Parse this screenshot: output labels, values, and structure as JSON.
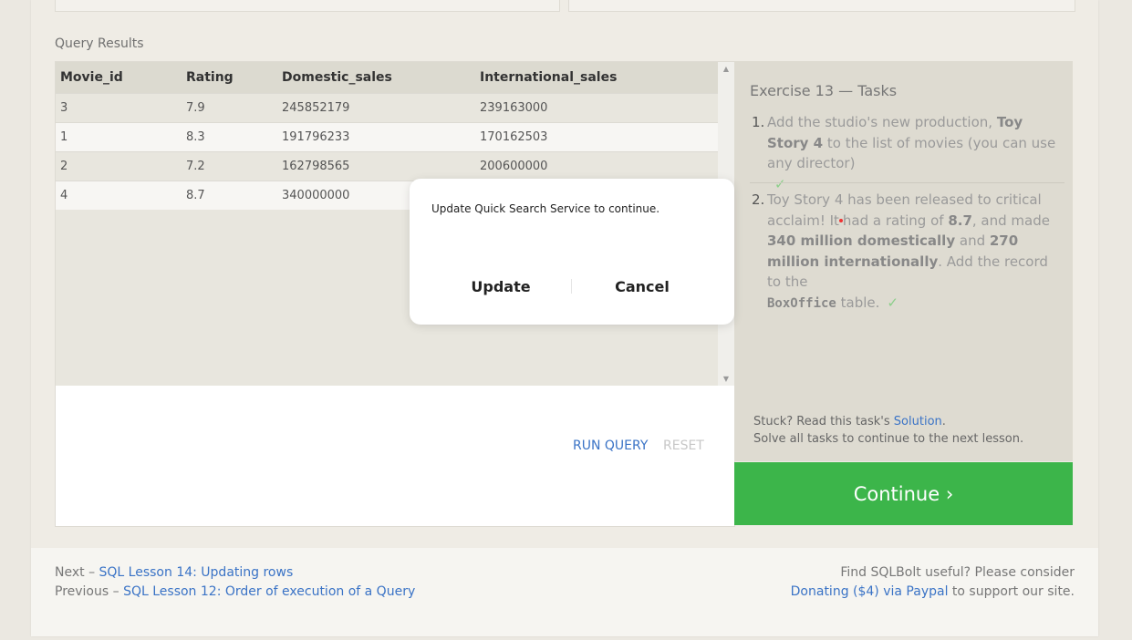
{
  "results": {
    "label": "Query Results",
    "columns": [
      "Movie_id",
      "Rating",
      "Domestic_sales",
      "International_sales"
    ],
    "rows": [
      [
        "3",
        "7.9",
        "245852179",
        "239163000"
      ],
      [
        "1",
        "8.3",
        "191796233",
        "170162503"
      ],
      [
        "2",
        "7.2",
        "162798565",
        "200600000"
      ],
      [
        "4",
        "8.7",
        "340000000",
        ""
      ]
    ],
    "run_query": "RUN QUERY",
    "reset": "RESET"
  },
  "tasks": {
    "title": "Exercise 13 — Tasks",
    "task1": {
      "num": "1.",
      "t1": "Add the studio's new production, ",
      "b1": "Toy Story 4",
      "t2": " to the list of movies (you can use any director)",
      "check": "✓"
    },
    "task2": {
      "num": "2.",
      "t1": "Toy Story 4 has been released to critical acclaim! It",
      "t2": "had a rating of ",
      "b1": "8.7",
      "t3": ", and made ",
      "b2": "340 million domestically",
      "t4": " and ",
      "b3": "270 million internationally",
      "t5": ". Add the record to the ",
      "code": "BoxOffice",
      "t6": " table.",
      "check": "✓"
    },
    "stuck_text": "Stuck? Read this task's ",
    "solution_link": "Solution",
    "stuck_end": ".",
    "solve_all": "Solve all tasks to continue to the next lesson."
  },
  "continue_label": "Continue ›",
  "footer": {
    "next_prefix": "Next – ",
    "next_link": "SQL Lesson 14: Updating rows",
    "prev_prefix": "Previous – ",
    "prev_link": "SQL Lesson 12: Order of execution of a Query",
    "useful": "Find SQLBolt useful? Please consider",
    "donate_link": "Donating ($4) via Paypal",
    "donate_suffix": " to support our site."
  },
  "dialog": {
    "message": "Update Quick Search Service to continue.",
    "update": "Update",
    "cancel": "Cancel"
  },
  "colors": {
    "accent": "#3cb54a",
    "link": "#3a73c6"
  }
}
